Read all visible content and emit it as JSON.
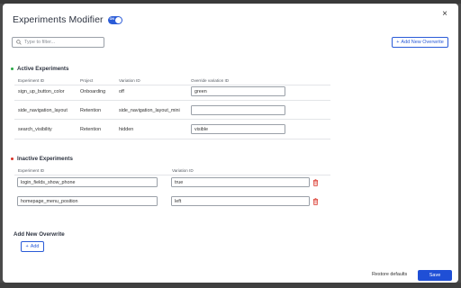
{
  "modal": {
    "title": "Experiments Modifier",
    "toggle_label": "ON",
    "close_label": "×"
  },
  "toolbar": {
    "filter_placeholder": "Type to filter...",
    "add_override_label": "Add New Overwrite",
    "add_override_icon": "plus-icon"
  },
  "active": {
    "title": "Active Experiments",
    "dot_color": "#27a844",
    "columns": [
      "Experiment ID",
      "Project",
      "Variation ID",
      "Override variation ID"
    ],
    "rows": [
      {
        "id": "sign_up_button_color",
        "project": "Onboarding",
        "variation": "off",
        "override": "green"
      },
      {
        "id": "side_navigation_layout",
        "project": "Retention",
        "variation": "side_navigation_layout_mini",
        "override": ""
      },
      {
        "id": "search_visibility",
        "project": "Retention",
        "variation": "hidden",
        "override": "visible"
      }
    ]
  },
  "inactive": {
    "title": "Inactive Experiments",
    "dot_color": "#d93025",
    "columns": [
      "Experiment ID",
      "Variation ID"
    ],
    "rows": [
      {
        "id": "login_fields_show_phone",
        "variation": "true"
      },
      {
        "id": "homepage_menu_position",
        "variation": "left"
      }
    ]
  },
  "add_new": {
    "title": "Add New Overwrite",
    "add_label": "Add"
  },
  "footer": {
    "restore_label": "Restore defaults",
    "save_label": "Save"
  },
  "colors": {
    "accent": "#2a5bd7",
    "trash": "#d93025"
  }
}
